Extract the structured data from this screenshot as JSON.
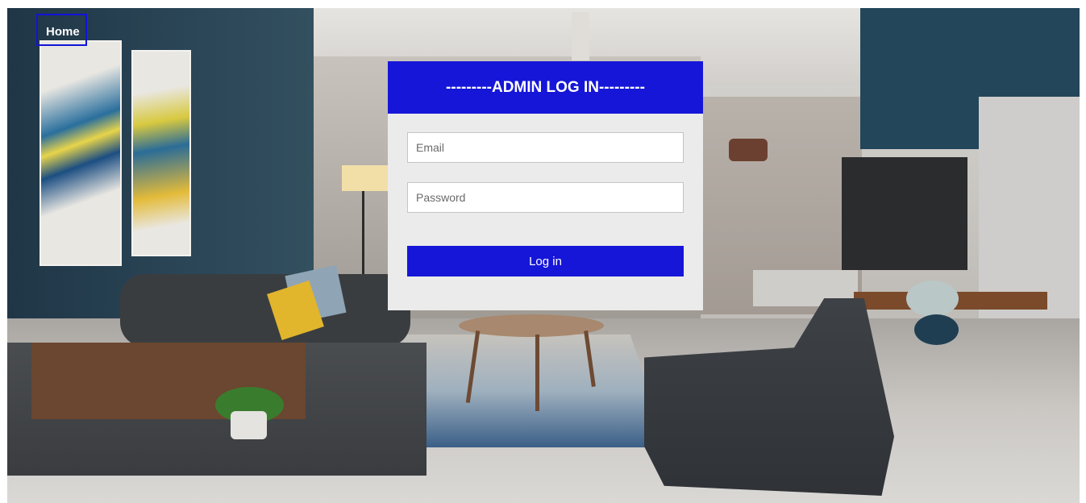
{
  "nav": {
    "home_label": "Home"
  },
  "login": {
    "title": "---------ADMIN LOG IN---------",
    "email_placeholder": "Email",
    "password_placeholder": "Password",
    "submit_label": "Log in"
  },
  "colors": {
    "accent": "#1616d9",
    "card_bg": "#ebebeb"
  }
}
